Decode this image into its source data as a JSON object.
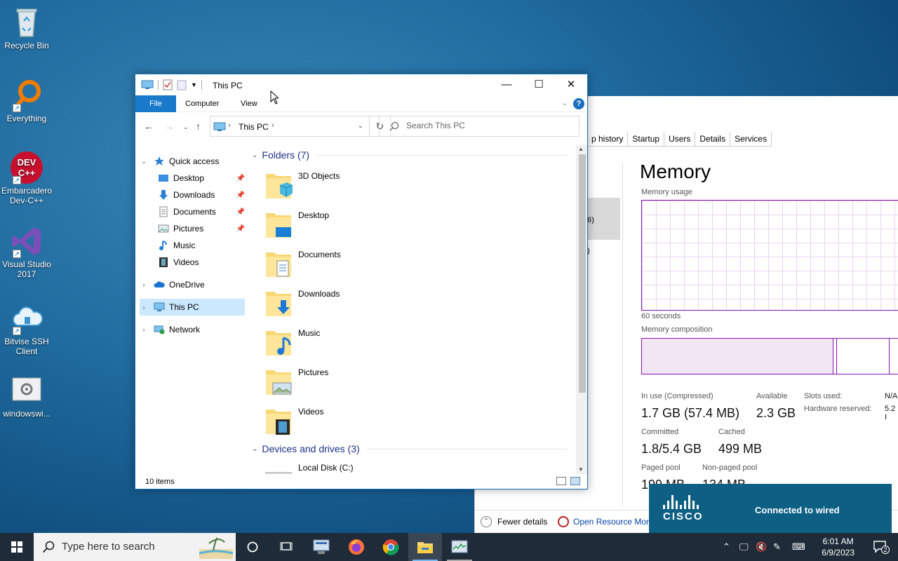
{
  "desktop": {
    "icons": [
      {
        "label": "Recycle Bin",
        "icon": "recycle-bin-icon"
      },
      {
        "label": "Everything",
        "icon": "everything-search-icon"
      },
      {
        "label": "Embarcadero Dev-C++",
        "icon": "devcpp-icon",
        "logo_text": "DEV C++"
      },
      {
        "label": "Visual Studio 2017",
        "icon": "visual-studio-icon"
      },
      {
        "label": "Bitvise SSH Client",
        "icon": "bitvise-icon"
      },
      {
        "label": "windowswi...",
        "icon": "settings-file-icon"
      }
    ]
  },
  "explorer": {
    "title": "This PC",
    "controls": {
      "minimize": "—",
      "maximize": "☐",
      "close": "✕"
    },
    "ribbon_tabs": [
      "File",
      "Computer",
      "View"
    ],
    "help": "?",
    "address": {
      "path_label": "This PC"
    },
    "search_placeholder": "Search This PC",
    "nav": {
      "quick_access": "Quick access",
      "quick_items": [
        "Desktop",
        "Downloads",
        "Documents",
        "Pictures",
        "Music",
        "Videos"
      ],
      "onedrive": "OneDrive",
      "this_pc": "This PC",
      "network": "Network"
    },
    "groups": {
      "folders_title": "Folders (7)",
      "devices_title": "Devices and drives (3)"
    },
    "folders": [
      "3D Objects",
      "Desktop",
      "Documents",
      "Downloads",
      "Music",
      "Pictures",
      "Videos"
    ],
    "drives": [
      "Local Disk (C:)"
    ],
    "status": "10 items"
  },
  "taskmanager": {
    "tabs": [
      "p history",
      "Startup",
      "Users",
      "Details",
      "Services"
    ],
    "side_text_1": "6)",
    "side_text_2": ")",
    "title": "Memory",
    "memory_usage_label": "Memory usage",
    "seconds_label": "60 seconds",
    "composition_label": "Memory composition",
    "stats": {
      "in_use_label": "In use (Compressed)",
      "in_use_value": "1.7 GB (57.4 MB)",
      "available_label": "Available",
      "available_value": "2.3 GB",
      "slots_label": "Slots used:",
      "slots_value": "N/A",
      "hw_reserved_label": "Hardware reserved:",
      "hw_reserved_value": "5.2 I",
      "committed_label": "Committed",
      "committed_value": "1.8/5.4 GB",
      "cached_label": "Cached",
      "cached_value": "499 MB",
      "paged_label": "Paged pool",
      "paged_value": "199 MB",
      "nonpaged_label": "Non-paged pool",
      "nonpaged_value": "134 MB"
    },
    "fewer_details": "Fewer details",
    "open_resmon": "Open Resource Moni"
  },
  "cisco_toast": {
    "brand": "CISCO",
    "message": "Connected to wired"
  },
  "taskbar": {
    "search_placeholder": "Type here to search",
    "clock_time": "6:01 AM",
    "clock_date": "6/9/2023",
    "notification_count": "2"
  },
  "colors": {
    "accent": "#1979ca",
    "memory_purple": "#8b12ae",
    "taskbar": "#1f2b38",
    "cisco": "#0d5f84"
  }
}
